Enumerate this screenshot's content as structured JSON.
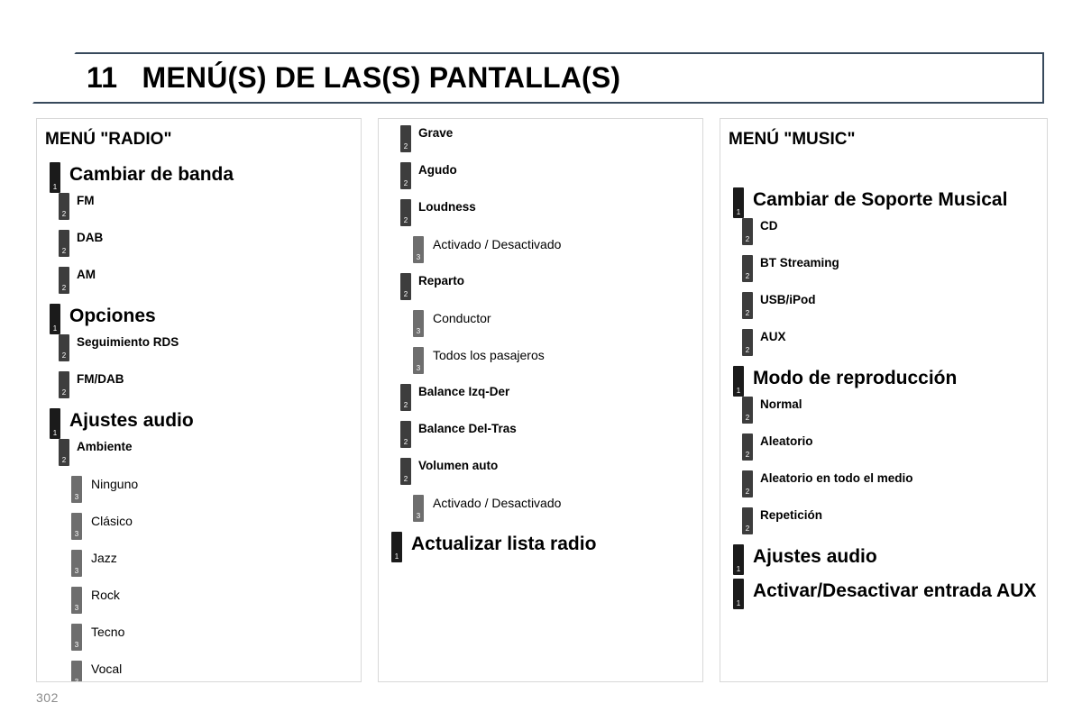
{
  "header": {
    "chapter_number": "11",
    "title": "MENÚ(S) DE LAS(S) PANTALLA(S)",
    "full_title": "11   MENÚ(S) DE LAS(S) PANTALLA(S)",
    "border_color": "#37495c"
  },
  "colors": {
    "level1_marker": "#1b1b1b",
    "level2_marker": "#3d3d3d",
    "level3_marker": "#6e6e6e",
    "panel_border": "#d8d8d8",
    "page_number": "#8b8b8b"
  },
  "panels": [
    {
      "id": "radio",
      "title": "MENÚ \"RADIO\"",
      "items": [
        {
          "level": 1,
          "label": "Cambiar de banda"
        },
        {
          "level": 2,
          "label": "FM"
        },
        {
          "level": 2,
          "label": "DAB"
        },
        {
          "level": 2,
          "label": "AM"
        },
        {
          "level": 1,
          "label": "Opciones"
        },
        {
          "level": 2,
          "label": "Seguimiento RDS"
        },
        {
          "level": 2,
          "label": "FM/DAB"
        },
        {
          "level": 1,
          "label": "Ajustes audio"
        },
        {
          "level": 2,
          "label": "Ambiente"
        },
        {
          "level": 3,
          "label": "Ninguno"
        },
        {
          "level": 3,
          "label": "Clásico"
        },
        {
          "level": 3,
          "label": "Jazz"
        },
        {
          "level": 3,
          "label": "Rock"
        },
        {
          "level": 3,
          "label": "Tecno"
        },
        {
          "level": 3,
          "label": "Vocal"
        }
      ]
    },
    {
      "id": "middle",
      "title": "",
      "items": [
        {
          "level": 2,
          "label": "Grave"
        },
        {
          "level": 2,
          "label": "Agudo"
        },
        {
          "level": 2,
          "label": "Loudness"
        },
        {
          "level": 3,
          "label": "Activado / Desactivado"
        },
        {
          "level": 2,
          "label": "Reparto"
        },
        {
          "level": 3,
          "label": "Conductor"
        },
        {
          "level": 3,
          "label": "Todos los pasajeros"
        },
        {
          "level": 2,
          "label": "Balance Izq-Der"
        },
        {
          "level": 2,
          "label": "Balance Del-Tras"
        },
        {
          "level": 2,
          "label": "Volumen auto"
        },
        {
          "level": 3,
          "label": "Activado / Desactivado"
        },
        {
          "level": 1,
          "label": "Actualizar lista radio"
        }
      ]
    },
    {
      "id": "music",
      "title": "MENÚ \"MUSIC\"",
      "items": [
        {
          "level": 1,
          "label": "Cambiar de Soporte Musical"
        },
        {
          "level": 2,
          "label": "CD"
        },
        {
          "level": 2,
          "label": "BT Streaming"
        },
        {
          "level": 2,
          "label": "USB/iPod"
        },
        {
          "level": 2,
          "label": "AUX"
        },
        {
          "level": 1,
          "label": "Modo de reproducción"
        },
        {
          "level": 2,
          "label": "Normal"
        },
        {
          "level": 2,
          "label": "Aleatorio"
        },
        {
          "level": 2,
          "label": "Aleatorio en todo el medio"
        },
        {
          "level": 2,
          "label": "Repetición"
        },
        {
          "level": 1,
          "label": "Ajustes audio"
        },
        {
          "level": 1,
          "label": "Activar/Desactivar entrada AUX"
        }
      ]
    }
  ],
  "footer": {
    "page_number": "302"
  }
}
